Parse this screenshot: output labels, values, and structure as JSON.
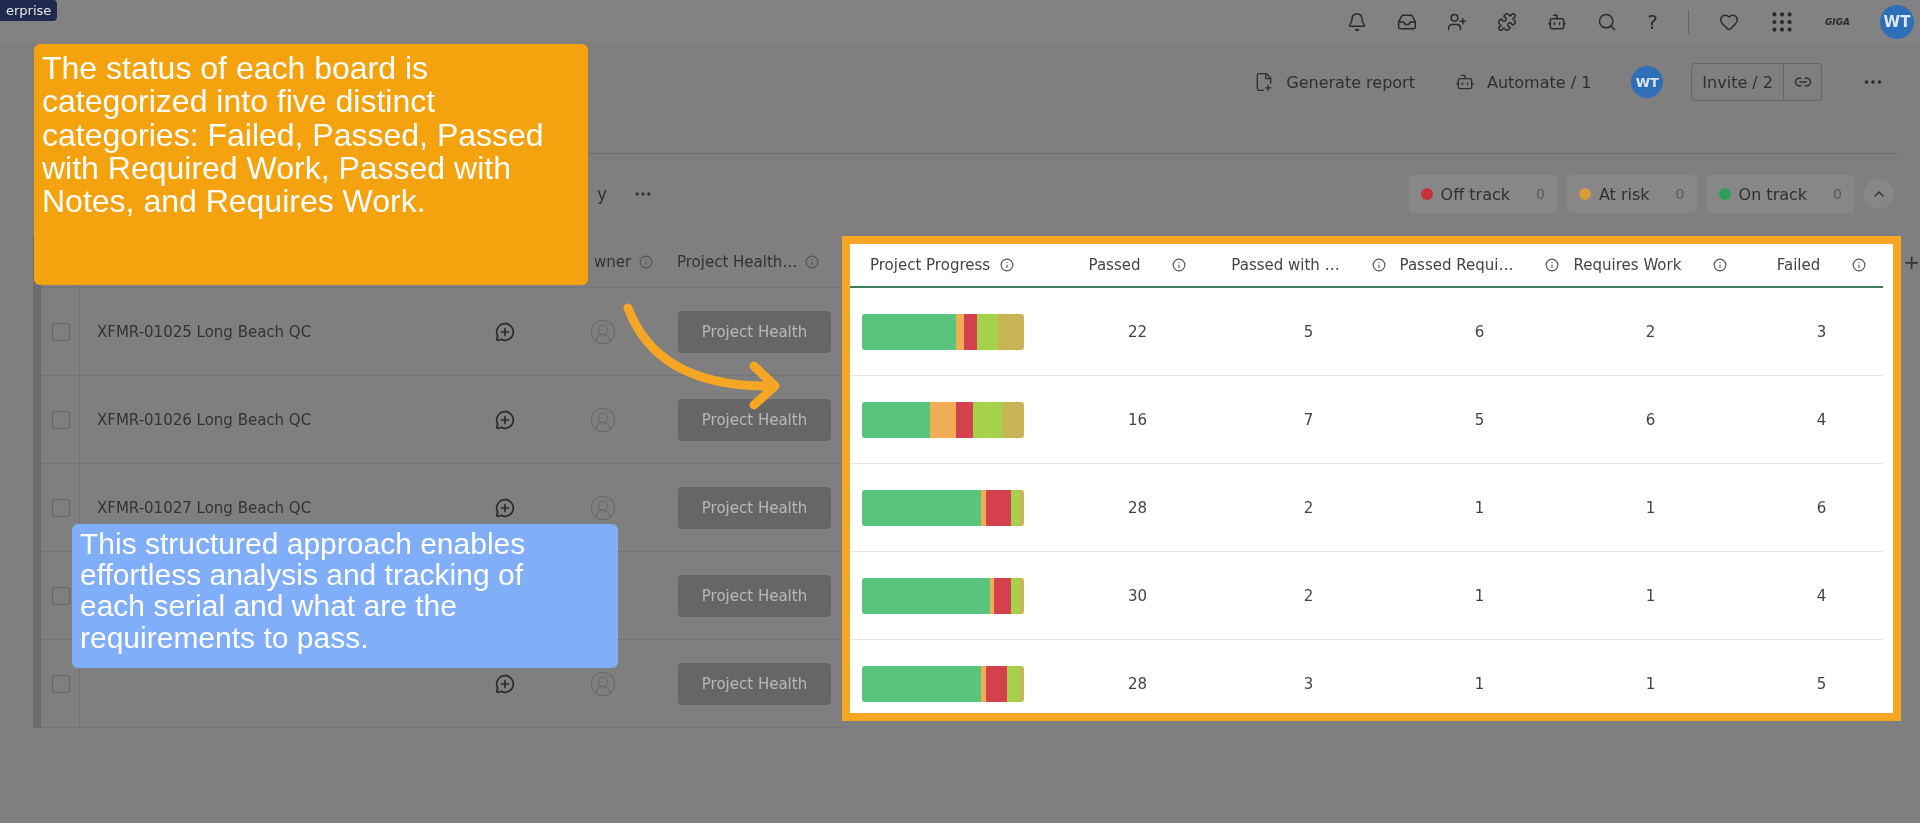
{
  "top_bar": {
    "badge": "erprise",
    "help": "?",
    "logo": "GIGA",
    "avatar": "WT"
  },
  "actions": {
    "generate_report": "Generate report",
    "automate": "Automate / 1",
    "avatar": "WT",
    "invite": "Invite / 2"
  },
  "toolbar": {
    "fragment": "y"
  },
  "status_filters": [
    {
      "label": "Off track",
      "count": "0",
      "color": "#c8323f"
    },
    {
      "label": "At risk",
      "count": "0",
      "color": "#d99a3a"
    },
    {
      "label": "On track",
      "count": "0",
      "color": "#2f9e57"
    }
  ],
  "board": {
    "columns": [
      "wner",
      "Project Health…"
    ],
    "progress_columns": [
      "Project Progress",
      "Passed",
      "Passed with …",
      "Passed Requi…",
      "Requires Work",
      "Failed"
    ],
    "add_column": "+",
    "rows": [
      {
        "name": "XFMR-01025 Long Beach QC",
        "checked": false,
        "health": "Project Health",
        "values": [
          "22",
          "5",
          "6",
          "2",
          "3"
        ]
      },
      {
        "name": "XFMR-01026 Long Beach QC",
        "checked": false,
        "health": "Project Health",
        "values": [
          "16",
          "7",
          "5",
          "6",
          "4"
        ]
      },
      {
        "name": "XFMR-01027 Long Beach QC",
        "checked": false,
        "health": "Project Health",
        "values": [
          "28",
          "2",
          "1",
          "1",
          "6"
        ]
      },
      {
        "checked": false,
        "health": "Project Health",
        "values": [
          "30",
          "2",
          "1",
          "1",
          "4"
        ]
      },
      {
        "checked": false,
        "health": "Project Health",
        "values": [
          "28",
          "3",
          "1",
          "1",
          "5"
        ]
      }
    ]
  },
  "callouts": [
    {
      "text": "The status of each board is categorized into five distinct categories: Failed, Passed, Passed with Required Work, Passed with Notes, and Requires Work.",
      "color": "#f5a20f"
    },
    {
      "text": "This structured approach enables effortless analysis and tracking of each serial and what are the requirements to pass.",
      "color": "#80aef8"
    }
  ]
}
